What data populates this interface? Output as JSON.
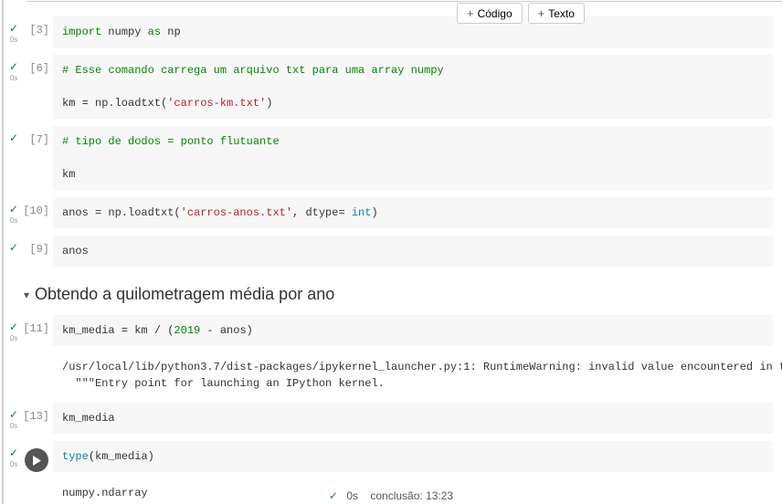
{
  "toolbar": {
    "code_label": "Código",
    "text_label": "Texto"
  },
  "cells": [
    {
      "num": "[3]",
      "code": "import numpy as np"
    },
    {
      "num": "[6]",
      "code": "# Esse comando carrega um arquivo txt para uma array numpy\n\nkm = np.loadtxt('carros-km.txt')"
    },
    {
      "num": "[7]",
      "code": "# tipo de dodos = ponto flutuante\n\nkm"
    },
    {
      "num": "[10]",
      "code": "anos = np.loadtxt('carros-anos.txt', dtype= int)"
    },
    {
      "num": "[9]",
      "code": "anos"
    }
  ],
  "heading": "Obtendo a quilometragem média por ano",
  "cells2": [
    {
      "num": "[11]",
      "code": "km_media = km / (2019 - anos)"
    },
    {
      "output": "/usr/local/lib/python3.7/dist-packages/ipykernel_launcher.py:1: RuntimeWarning: invalid value encountered in true_divide\n  \"\"\"Entry point for launching an IPython kernel."
    },
    {
      "num": "[13]",
      "code": "km_media"
    },
    {
      "run": true,
      "code": "type(km_media)"
    },
    {
      "output": "numpy.ndarray"
    }
  ],
  "footer": {
    "time": "0s",
    "label": "conclusão:",
    "stamp": "13:23"
  },
  "status_time": "0s"
}
